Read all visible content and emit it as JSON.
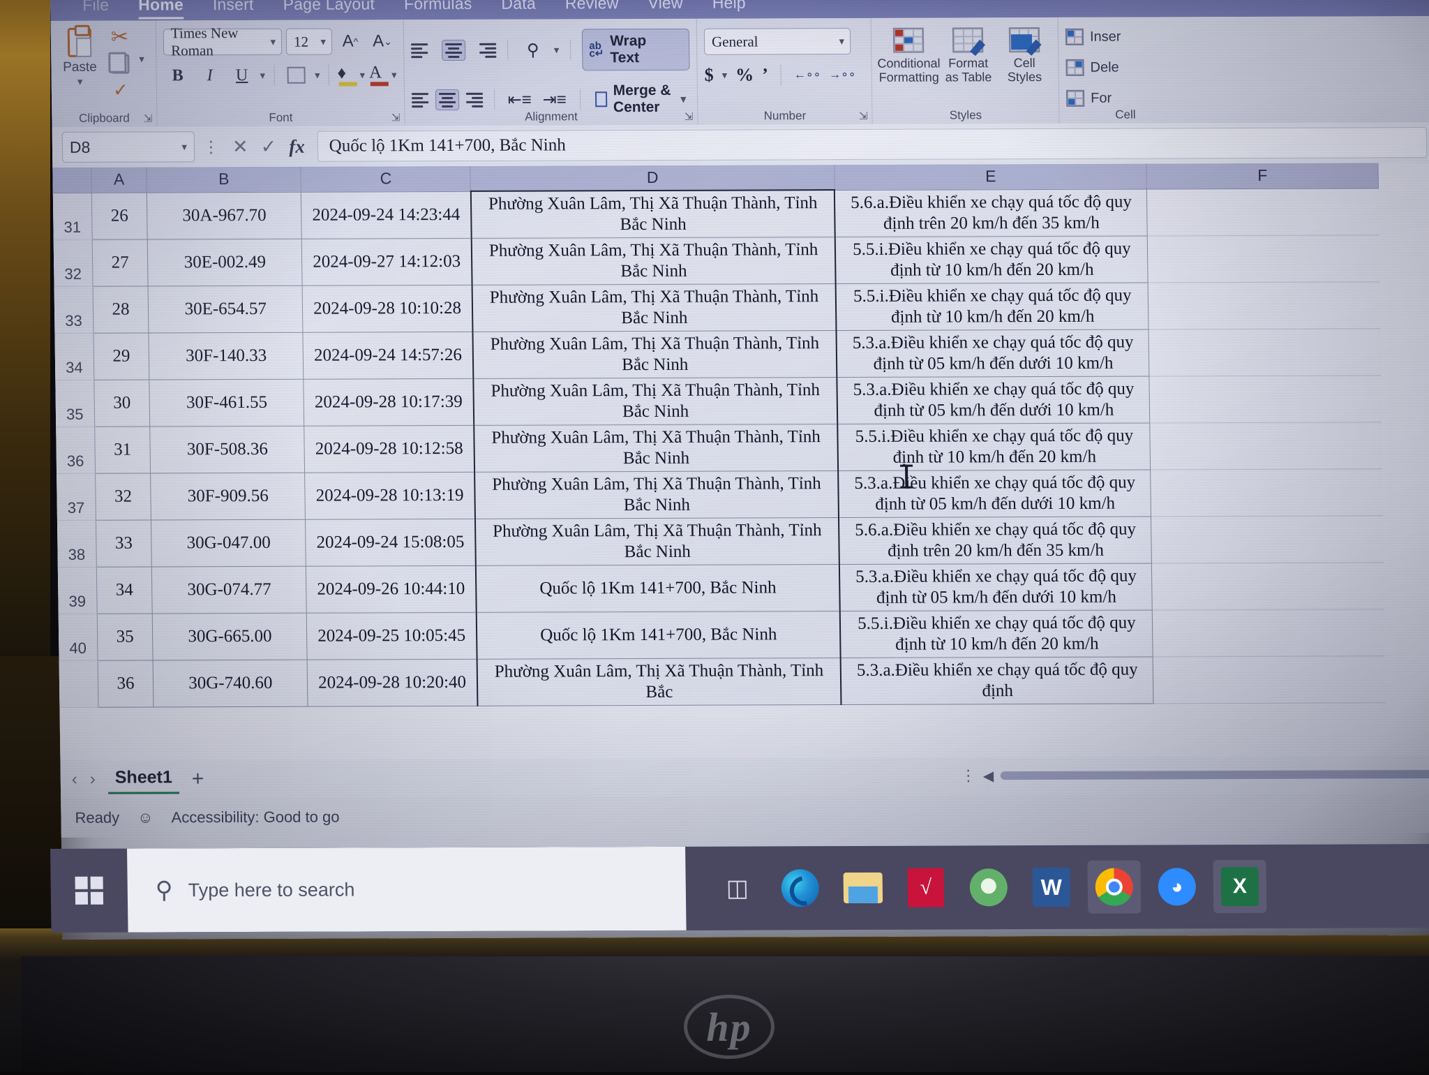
{
  "ribbon": {
    "tabs": [
      {
        "label": "File",
        "active": false
      },
      {
        "label": "Home",
        "active": true
      },
      {
        "label": "Insert",
        "active": false
      },
      {
        "label": "Page Layout",
        "active": false
      },
      {
        "label": "Formulas",
        "active": false
      },
      {
        "label": "Data",
        "active": false
      },
      {
        "label": "Review",
        "active": false
      },
      {
        "label": "View",
        "active": false
      },
      {
        "label": "Help",
        "active": false
      }
    ],
    "clipboard": {
      "group_label": "Clipboard",
      "paste_label": "Paste",
      "cut_icon": "scissors-icon",
      "copy_icon": "copy-icon",
      "format_painter_icon": "format-painter-icon"
    },
    "font": {
      "group_label": "Font",
      "font_name": "Times New Roman",
      "font_size": "12",
      "grow_font": "A",
      "shrink_font": "A",
      "bold": "B",
      "italic": "I",
      "underline": "U",
      "borders_icon": "borders-icon",
      "fill_color_icon": "fill-color-icon",
      "font_color_icon": "font-color-icon"
    },
    "alignment": {
      "group_label": "Alignment",
      "wrap_text": "Wrap Text",
      "merge_center": "Merge & Center",
      "orientation_icon": "orientation-icon",
      "decrease_indent_icon": "decrease-indent-icon",
      "increase_indent_icon": "increase-indent-icon"
    },
    "number": {
      "group_label": "Number",
      "format": "General",
      "accounting": "$",
      "percent": "%",
      "comma": "’",
      "increase_decimal_icon": "increase-decimal-icon",
      "decrease_decimal_icon": "decrease-decimal-icon"
    },
    "styles": {
      "group_label": "Styles",
      "conditional_formatting": "Conditional Formatting",
      "format_as_table": "Format as Table",
      "cell_styles": "Cell Styles"
    },
    "cells": {
      "group_label": "Cell",
      "insert": "Inser",
      "delete": "Dele",
      "format": "For"
    }
  },
  "formula_bar": {
    "name_box": "D8",
    "cancel_icon": "close-icon",
    "enter_icon": "check-icon",
    "function_icon": "fx",
    "content": "Quốc lộ 1Km 141+700, Bắc Ninh"
  },
  "grid": {
    "column_headers": [
      "A",
      "B",
      "C",
      "D",
      "E",
      "F"
    ],
    "selected_column": "D",
    "rows": [
      {
        "row_number": "31",
        "a": "26",
        "b": "30A-967.70",
        "c": "2024-09-24 14:23:44",
        "d": "Phường Xuân Lâm, Thị Xã Thuận Thành, Tỉnh Bắc Ninh",
        "e": "5.6.a.Điều khiển xe chạy quá tốc độ quy định trên 20 km/h đến 35 km/h"
      },
      {
        "row_number": "32",
        "a": "27",
        "b": "30E-002.49",
        "c": "2024-09-27 14:12:03",
        "d": "Phường Xuân Lâm, Thị Xã Thuận Thành, Tỉnh Bắc Ninh",
        "e": "5.5.i.Điều khiển xe chạy quá tốc độ quy định từ 10 km/h đến 20 km/h"
      },
      {
        "row_number": "33",
        "a": "28",
        "b": "30E-654.57",
        "c": "2024-09-28 10:10:28",
        "d": "Phường Xuân Lâm, Thị Xã Thuận Thành, Tỉnh Bắc Ninh",
        "e": "5.5.i.Điều khiển xe chạy quá tốc độ quy định từ 10 km/h đến 20 km/h"
      },
      {
        "row_number": "34",
        "a": "29",
        "b": "30F-140.33",
        "c": "2024-09-24 14:57:26",
        "d": "Phường Xuân Lâm, Thị Xã Thuận Thành, Tỉnh Bắc Ninh",
        "e": "5.3.a.Điều khiển xe chạy quá tốc độ quy định từ 05 km/h đến dưới 10 km/h"
      },
      {
        "row_number": "35",
        "a": "30",
        "b": "30F-461.55",
        "c": "2024-09-28 10:17:39",
        "d": "Phường Xuân Lâm, Thị Xã Thuận Thành, Tỉnh Bắc Ninh",
        "e": "5.3.a.Điều khiển xe chạy quá tốc độ quy định từ 05 km/h đến dưới 10 km/h"
      },
      {
        "row_number": "36",
        "a": "31",
        "b": "30F-508.36",
        "c": "2024-09-28 10:12:58",
        "d": "Phường Xuân Lâm, Thị Xã Thuận Thành, Tỉnh Bắc Ninh",
        "e": "5.5.i.Điều khiển xe chạy quá tốc độ quy định từ 10 km/h đến 20 km/h"
      },
      {
        "row_number": "37",
        "a": "32",
        "b": "30F-909.56",
        "c": "2024-09-28 10:13:19",
        "d": "Phường Xuân Lâm, Thị Xã Thuận Thành, Tỉnh Bắc Ninh",
        "e": "5.3.a.Điều khiển xe chạy quá tốc độ quy định từ 05 km/h đến dưới 10 km/h"
      },
      {
        "row_number": "38",
        "a": "33",
        "b": "30G-047.00",
        "c": "2024-09-24 15:08:05",
        "d": "Phường Xuân Lâm, Thị Xã Thuận Thành, Tỉnh Bắc Ninh",
        "e": "5.6.a.Điều khiển xe chạy quá tốc độ quy định trên 20 km/h đến 35 km/h"
      },
      {
        "row_number": "39",
        "a": "34",
        "b": "30G-074.77",
        "c": "2024-09-26 10:44:10",
        "d": "Quốc lộ 1Km 141+700, Bắc Ninh",
        "e": "5.3.a.Điều khiển xe chạy quá tốc độ quy định từ 05 km/h đến dưới 10 km/h"
      },
      {
        "row_number": "40",
        "a": "35",
        "b": "30G-665.00",
        "c": "2024-09-25 10:05:45",
        "d": "Quốc lộ 1Km 141+700, Bắc Ninh",
        "e": "5.5.i.Điều khiển xe chạy quá tốc độ quy định từ 10 km/h đến 20 km/h"
      },
      {
        "row_number": "",
        "a": "36",
        "b": "30G-740.60",
        "c": "2024-09-28 10:20:40",
        "d": "Phường Xuân Lâm, Thị Xã Thuận Thành, Tỉnh Bắc",
        "e": "5.3.a.Điều khiển xe chạy quá tốc độ quy định"
      }
    ]
  },
  "sheet_tabs": {
    "prev_icon": "chevron-left-icon",
    "next_icon": "chevron-right-icon",
    "active_sheet": "Sheet1",
    "add_sheet": "+"
  },
  "status_bar": {
    "state": "Ready",
    "accessibility": "Accessibility: Good to go"
  },
  "taskbar": {
    "start_icon": "windows-start-icon",
    "search_placeholder": "Type here to search",
    "search_icon": "search-icon",
    "items": [
      {
        "name": "task-view-icon",
        "label": ""
      },
      {
        "name": "edge-icon",
        "label": ""
      },
      {
        "name": "file-explorer-icon",
        "label": ""
      },
      {
        "name": "vnedoc-icon",
        "label": ""
      },
      {
        "name": "green-app-icon",
        "label": ""
      },
      {
        "name": "word-icon",
        "label": "W"
      },
      {
        "name": "chrome-icon",
        "label": ""
      },
      {
        "name": "zalo-icon",
        "label": ""
      },
      {
        "name": "excel-icon",
        "label": "X"
      }
    ]
  },
  "device": {
    "brand_logo": "hp"
  }
}
